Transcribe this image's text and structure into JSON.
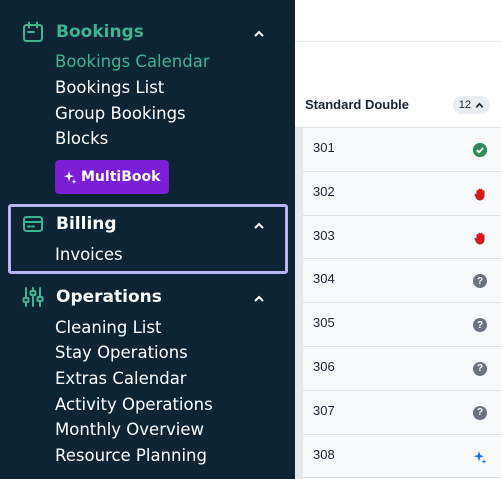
{
  "sidebar": {
    "sections": [
      {
        "title": "Bookings",
        "icon": "calendar-icon",
        "items": [
          "Bookings Calendar",
          "Bookings List",
          "Group Bookings",
          "Blocks"
        ],
        "active_item": "Bookings Calendar"
      },
      {
        "title": "Billing",
        "icon": "card-icon",
        "items": [
          "Invoices"
        ]
      },
      {
        "title": "Operations",
        "icon": "sliders-icon",
        "items": [
          "Cleaning List",
          "Stay Operations",
          "Extras Calendar",
          "Activity Operations",
          "Monthly Overview",
          "Resource Planning"
        ]
      }
    ],
    "multibook_label": "MultiBook"
  },
  "grid": {
    "room_type": "Standard Double",
    "room_count": "12",
    "rooms": [
      {
        "number": "301",
        "status": "check-icon"
      },
      {
        "number": "302",
        "status": "hand-stop-icon"
      },
      {
        "number": "303",
        "status": "hand-stop-icon"
      },
      {
        "number": "304",
        "status": "question-icon"
      },
      {
        "number": "305",
        "status": "question-icon"
      },
      {
        "number": "306",
        "status": "question-icon"
      },
      {
        "number": "307",
        "status": "question-icon"
      },
      {
        "number": "308",
        "status": "sparkle-icon"
      }
    ]
  },
  "colors": {
    "sidebar_bg": "#0c2433",
    "accent": "#3fb58f",
    "multibook_bg": "#7a1fd6",
    "highlight_border": "#b7b5f3"
  }
}
